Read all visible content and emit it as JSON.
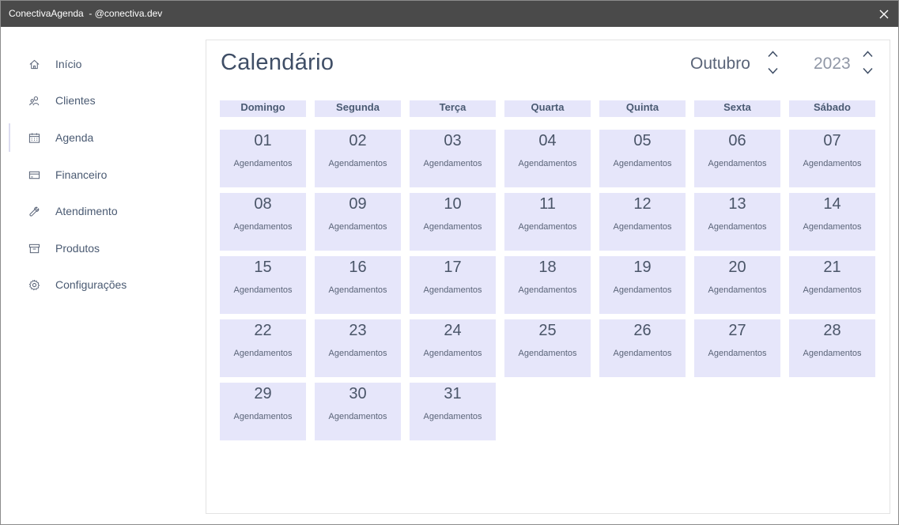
{
  "window": {
    "title": "ConectivaAgenda  - @conectiva.dev"
  },
  "sidebar": {
    "items": [
      {
        "label": "Início",
        "icon": "home-icon"
      },
      {
        "label": "Clientes",
        "icon": "users-icon"
      },
      {
        "label": "Agenda",
        "icon": "calendar-icon",
        "active": true
      },
      {
        "label": "Financeiro",
        "icon": "credit-card-icon"
      },
      {
        "label": "Atendimento",
        "icon": "wrench-icon"
      },
      {
        "label": "Produtos",
        "icon": "archive-box-icon"
      },
      {
        "label": "Configurações",
        "icon": "gear-icon"
      }
    ]
  },
  "calendar": {
    "title": "Calendário",
    "month": "Outubro",
    "year": "2023",
    "weekdays": [
      "Domingo",
      "Segunda",
      "Terça",
      "Quarta",
      "Quinta",
      "Sexta",
      "Sábado"
    ],
    "day_label": "Agendamentos",
    "days": [
      "01",
      "02",
      "03",
      "04",
      "05",
      "06",
      "07",
      "08",
      "09",
      "10",
      "11",
      "12",
      "13",
      "14",
      "15",
      "16",
      "17",
      "18",
      "19",
      "20",
      "21",
      "22",
      "23",
      "24",
      "25",
      "26",
      "27",
      "28",
      "29",
      "30",
      "31"
    ]
  },
  "colors": {
    "titlebar": "#4a4a4a",
    "cell": "#e6e6fa",
    "text": "#3f4e66"
  }
}
